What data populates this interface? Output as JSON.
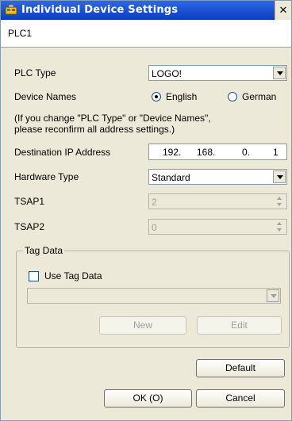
{
  "window": {
    "title": "Individual Device Settings",
    "close_glyph": "✕"
  },
  "header": {
    "device": "PLC1"
  },
  "plc_type": {
    "label": "PLC Type",
    "value": "LOGO!"
  },
  "device_names": {
    "label": "Device Names",
    "options": [
      {
        "label": "English",
        "selected": true
      },
      {
        "label": "German",
        "selected": false
      }
    ]
  },
  "note": {
    "line1": "(If you change \"PLC Type\" or \"Device Names\",",
    "line2": "please reconfirm all address settings.)"
  },
  "destination_ip": {
    "label": "Destination IP Address",
    "octets": [
      "192.",
      "168.",
      "0.",
      "1"
    ]
  },
  "hardware_type": {
    "label": "Hardware Type",
    "value": "Standard"
  },
  "tsap1": {
    "label": "TSAP1",
    "value": "2"
  },
  "tsap2": {
    "label": "TSAP2",
    "value": "0"
  },
  "tag_data": {
    "group_label": "Tag Data",
    "checkbox_label": "Use Tag Data",
    "checked": false,
    "dropdown_value": "",
    "new_label": "New",
    "edit_label": "Edit"
  },
  "buttons": {
    "default_label": "Default",
    "ok_label": "OK (O)",
    "cancel_label": "Cancel"
  },
  "icons": {
    "app": "app-device-icon",
    "close": "close-icon"
  },
  "colors": {
    "titlebar": "#1e55d3",
    "dialog_bg": "#ece9d8"
  }
}
